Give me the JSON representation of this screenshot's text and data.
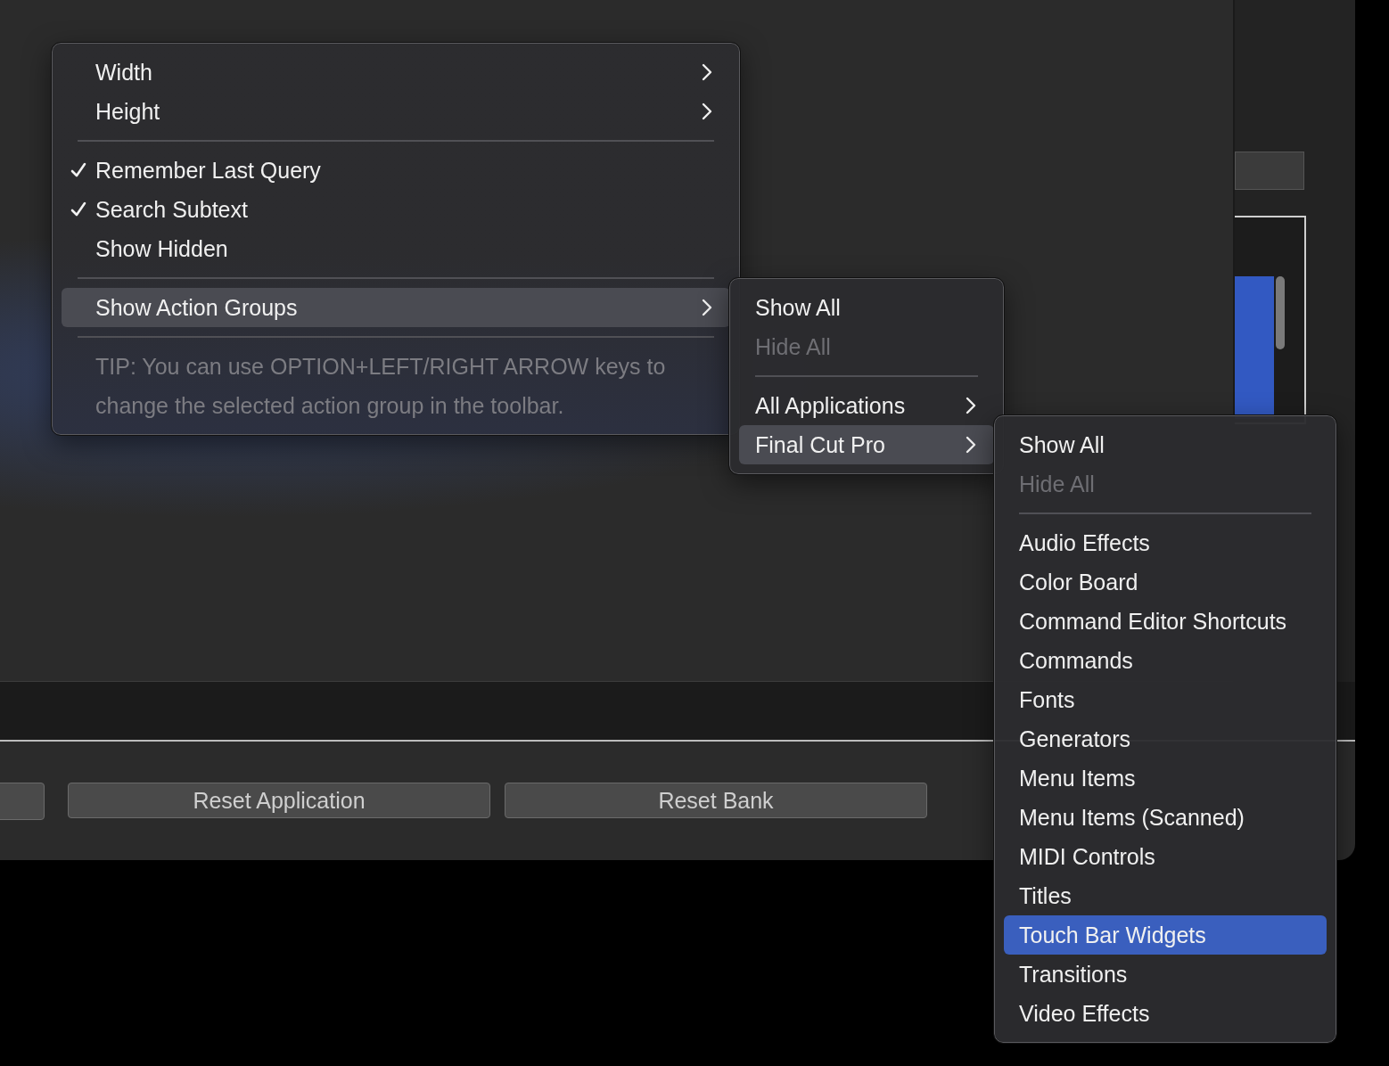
{
  "menus": [
    {
      "items": [
        {
          "kind": "item",
          "label": "Width",
          "checked": false,
          "disabled": false,
          "selected": false,
          "submenu": true
        },
        {
          "kind": "item",
          "label": "Height",
          "checked": false,
          "disabled": false,
          "selected": false,
          "submenu": true
        },
        {
          "kind": "separator"
        },
        {
          "kind": "item",
          "label": "Remember Last Query",
          "checked": true,
          "disabled": false,
          "selected": false,
          "submenu": false
        },
        {
          "kind": "item",
          "label": "Search Subtext",
          "checked": true,
          "disabled": false,
          "selected": false,
          "submenu": false
        },
        {
          "kind": "item",
          "label": "Show Hidden",
          "checked": false,
          "disabled": false,
          "selected": false,
          "submenu": false
        },
        {
          "kind": "separator"
        },
        {
          "kind": "item",
          "label": "Show Action Groups",
          "checked": false,
          "disabled": false,
          "selected": true,
          "submenu": true
        },
        {
          "kind": "separator"
        },
        {
          "kind": "tip",
          "label": "TIP: You can use OPTION+LEFT/RIGHT ARROW keys to change the selected action group in the toolbar."
        }
      ]
    },
    {
      "items": [
        {
          "kind": "item",
          "label": "Show All",
          "checked": false,
          "disabled": false,
          "selected": false,
          "submenu": false
        },
        {
          "kind": "item",
          "label": "Hide All",
          "checked": false,
          "disabled": true,
          "selected": false,
          "submenu": false
        },
        {
          "kind": "separator"
        },
        {
          "kind": "item",
          "label": "All Applications",
          "checked": false,
          "disabled": false,
          "selected": false,
          "submenu": true
        },
        {
          "kind": "item",
          "label": "Final Cut Pro",
          "checked": false,
          "disabled": false,
          "selected": true,
          "submenu": true
        }
      ]
    },
    {
      "items": [
        {
          "kind": "item",
          "label": "Show All",
          "checked": false,
          "disabled": false,
          "selected": false,
          "submenu": false
        },
        {
          "kind": "item",
          "label": "Hide All",
          "checked": false,
          "disabled": true,
          "selected": false,
          "submenu": false
        },
        {
          "kind": "separator"
        },
        {
          "kind": "item",
          "label": "Audio Effects",
          "checked": false,
          "disabled": false,
          "selected": false,
          "submenu": false
        },
        {
          "kind": "item",
          "label": "Color Board",
          "checked": false,
          "disabled": false,
          "selected": false,
          "submenu": false
        },
        {
          "kind": "item",
          "label": "Command Editor Shortcuts",
          "checked": false,
          "disabled": false,
          "selected": false,
          "submenu": false
        },
        {
          "kind": "item",
          "label": "Commands",
          "checked": false,
          "disabled": false,
          "selected": false,
          "submenu": false
        },
        {
          "kind": "item",
          "label": "Fonts",
          "checked": false,
          "disabled": false,
          "selected": false,
          "submenu": false
        },
        {
          "kind": "item",
          "label": "Generators",
          "checked": false,
          "disabled": false,
          "selected": false,
          "submenu": false
        },
        {
          "kind": "item",
          "label": "Menu Items",
          "checked": false,
          "disabled": false,
          "selected": false,
          "submenu": false
        },
        {
          "kind": "item",
          "label": "Menu Items (Scanned)",
          "checked": false,
          "disabled": false,
          "selected": false,
          "submenu": false
        },
        {
          "kind": "item",
          "label": "MIDI Controls",
          "checked": false,
          "disabled": false,
          "selected": false,
          "submenu": false
        },
        {
          "kind": "item",
          "label": "Titles",
          "checked": false,
          "disabled": false,
          "selected": false,
          "submenu": false
        },
        {
          "kind": "item",
          "label": "Touch Bar Widgets",
          "checked": false,
          "disabled": false,
          "selected": true,
          "submenu": false
        },
        {
          "kind": "item",
          "label": "Transitions",
          "checked": false,
          "disabled": false,
          "selected": false,
          "submenu": false
        },
        {
          "kind": "item",
          "label": "Video Effects",
          "checked": false,
          "disabled": false,
          "selected": false,
          "submenu": false
        }
      ]
    }
  ],
  "bottom_buttons": [
    {
      "label": "Reset Application"
    },
    {
      "label": "Reset Bank"
    }
  ]
}
